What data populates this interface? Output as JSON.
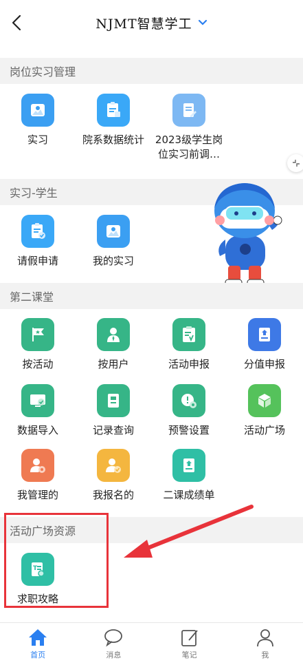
{
  "header": {
    "title": "NJMT智慧学工",
    "dropdown_icon": "chevron-down-icon",
    "back_icon": "chevron-left-icon"
  },
  "sections": [
    {
      "title": "岗位实习管理",
      "items": [
        {
          "label": "实习",
          "icon": "photo-icon",
          "color": "#3b9ff2"
        },
        {
          "label": "院系数据统计",
          "icon": "clipboard-chart-icon",
          "color": "#3aa8f7"
        },
        {
          "label": "2023级学生岗位实习前调…",
          "icon": "document-edit-icon",
          "color": "#7db8f3"
        }
      ]
    },
    {
      "title": "实习-学生",
      "items": [
        {
          "label": "请假申请",
          "icon": "clipboard-check-icon",
          "color": "#3aa8f7"
        },
        {
          "label": "我的实习",
          "icon": "photo-icon",
          "color": "#3b9ff2"
        }
      ]
    },
    {
      "title": "第二课堂",
      "items": [
        {
          "label": "按活动",
          "icon": "flag-icon",
          "color": "#36b587"
        },
        {
          "label": "按用户",
          "icon": "user-tie-icon",
          "color": "#36b587"
        },
        {
          "label": "活动申报",
          "icon": "clipboard-v-icon",
          "color": "#36b587"
        },
        {
          "label": "分值申报",
          "icon": "badge-doc-icon",
          "color": "#3e79e6"
        },
        {
          "label": "数据导入",
          "icon": "monitor-check-icon",
          "color": "#36b587"
        },
        {
          "label": "记录查询",
          "icon": "book-icon",
          "color": "#36b587"
        },
        {
          "label": "预警设置",
          "icon": "alert-gear-icon",
          "color": "#36b587"
        },
        {
          "label": "活动广场",
          "icon": "cube-icon",
          "color": "#55c25b"
        },
        {
          "label": "我管理的",
          "icon": "user-gear-icon",
          "color": "#ef7a52"
        },
        {
          "label": "我报名的",
          "icon": "user-check-icon",
          "color": "#f4b63f"
        },
        {
          "label": "二课成绩单",
          "icon": "certificate-icon",
          "color": "#2fbfa5"
        }
      ]
    },
    {
      "title": "活动广场资源",
      "items": [
        {
          "label": "求职攻略",
          "icon": "text-doc-search-icon",
          "color": "#2fbfa5"
        }
      ]
    }
  ],
  "tabbar": [
    {
      "label": "首页",
      "icon": "home-icon",
      "active": true
    },
    {
      "label": "消息",
      "icon": "chat-bubble-icon",
      "active": false
    },
    {
      "label": "笔记",
      "icon": "note-edit-icon",
      "active": false
    },
    {
      "label": "我",
      "icon": "person-icon",
      "active": false
    }
  ],
  "colors": {
    "accent": "#2a7ff0",
    "annotation": "#e8333a"
  }
}
